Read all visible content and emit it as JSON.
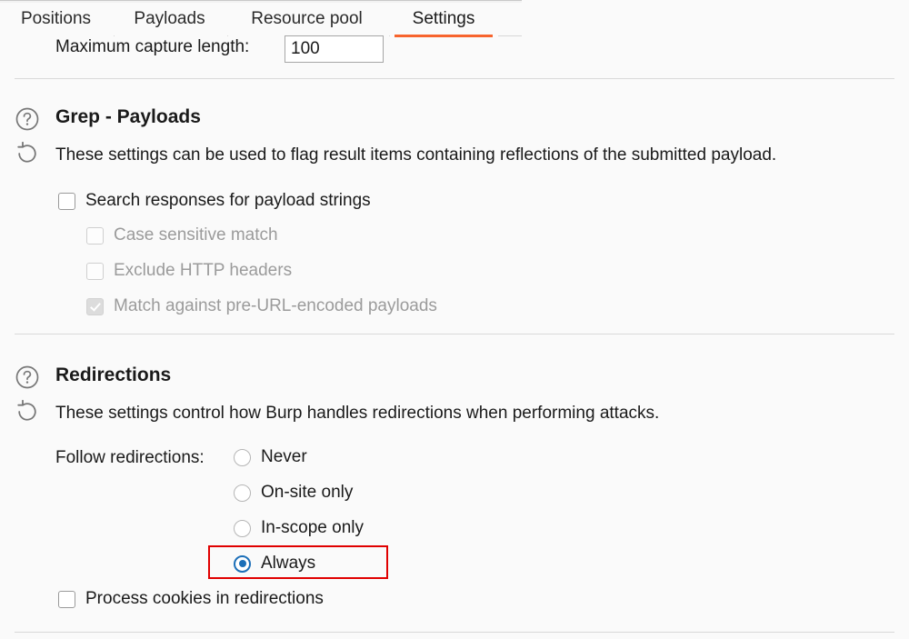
{
  "window": {
    "accent_color": "#f7642d",
    "background_color": "#fafafa",
    "selected_radio_color": "#1c6fb8",
    "highlight_box_color": "#e00000"
  },
  "tabs": [
    {
      "label": "Positions",
      "active": false
    },
    {
      "label": "Payloads",
      "active": false
    },
    {
      "label": "Resource pool",
      "active": false
    },
    {
      "label": "Settings",
      "active": true
    }
  ],
  "capture": {
    "label": "Maximum capture length:",
    "value": "100"
  },
  "sections": [
    {
      "id": "grep-payloads",
      "title": "Grep - Payloads",
      "description": "These settings can be used to flag result items containing reflections of the submitted payload.",
      "help_icon": "question-circle-icon",
      "reset_icon": "reset-arrow-icon",
      "checkboxes": [
        {
          "label": "Search responses for payload strings",
          "checked": false,
          "disabled": false
        },
        {
          "label": "Case sensitive match",
          "checked": false,
          "disabled": true
        },
        {
          "label": "Exclude HTTP headers",
          "checked": false,
          "disabled": true
        },
        {
          "label": "Match against pre-URL-encoded payloads",
          "checked": true,
          "disabled": true
        }
      ]
    },
    {
      "id": "redirections",
      "title": "Redirections",
      "description": "These settings control how Burp handles redirections when performing attacks.",
      "help_icon": "question-circle-icon",
      "reset_icon": "reset-arrow-icon",
      "radio_group": {
        "label": "Follow redirections:",
        "options": [
          {
            "label": "Never",
            "selected": false
          },
          {
            "label": "On-site only",
            "selected": false
          },
          {
            "label": "In-scope only",
            "selected": false
          },
          {
            "label": "Always",
            "selected": true,
            "highlighted": true
          }
        ]
      },
      "checkboxes": [
        {
          "label": "Process cookies in redirections",
          "checked": false,
          "disabled": false
        }
      ]
    }
  ]
}
